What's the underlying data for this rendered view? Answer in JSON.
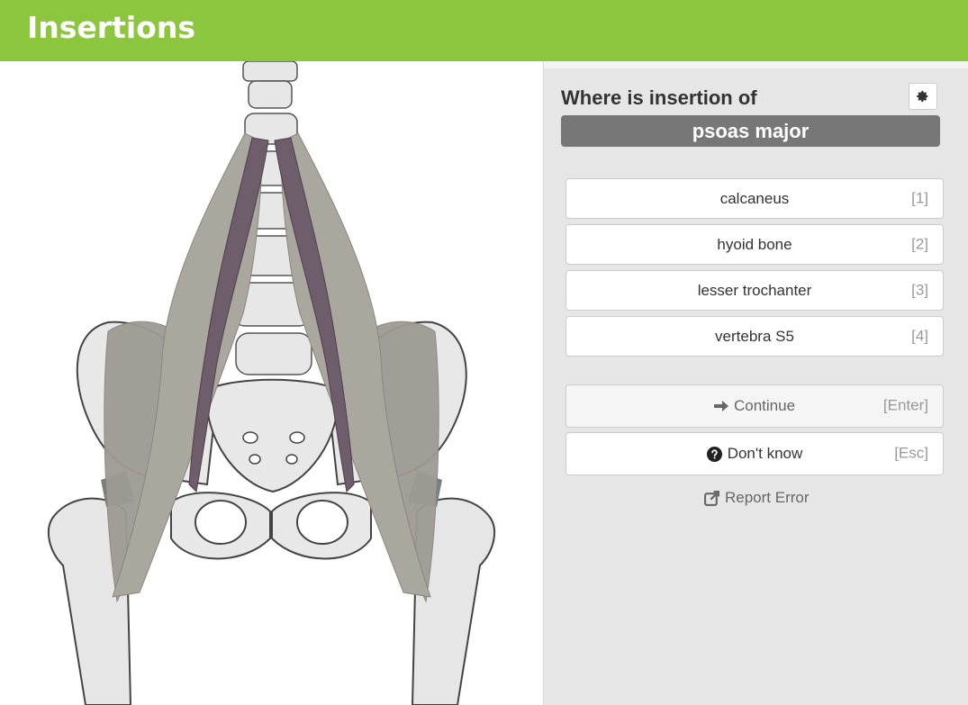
{
  "app": {
    "title": "Insertions"
  },
  "quiz": {
    "question": "Where is insertion of",
    "term": "psoas major",
    "options": [
      {
        "label": "calcaneus",
        "key": "[1]"
      },
      {
        "label": "hyoid bone",
        "key": "[2]"
      },
      {
        "label": "lesser trochanter",
        "key": "[3]"
      },
      {
        "label": "vertebra S5",
        "key": "[4]"
      }
    ]
  },
  "actions": {
    "continue_label": "Continue",
    "continue_key": "[Enter]",
    "dontknow_label": "Don't know",
    "dontknow_key": "[Esc]",
    "report_label": "Report Error"
  },
  "icons": {
    "settings": "gear-icon",
    "continue": "arrow-right-icon",
    "dontknow": "question-circle-icon",
    "report": "external-link-icon"
  },
  "colors": {
    "header": "#8cc63f",
    "term_bg": "#777777",
    "muscle": "#6e5d6b"
  }
}
